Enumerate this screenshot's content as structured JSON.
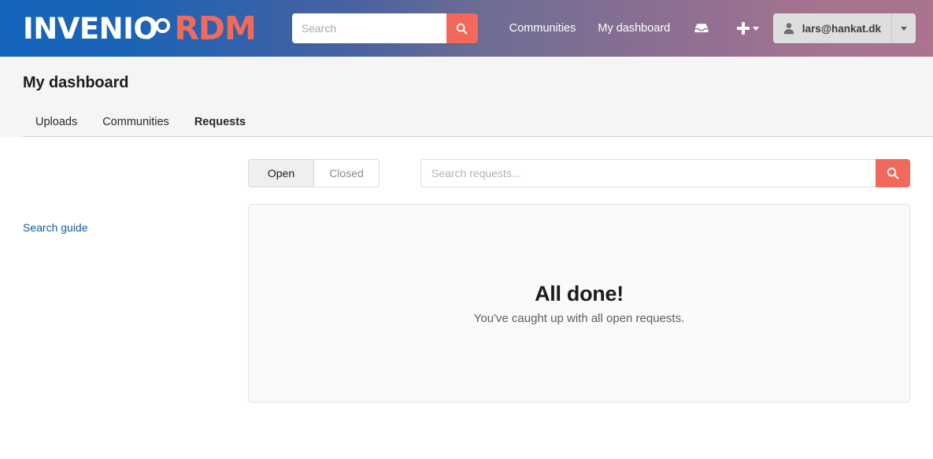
{
  "brand": {
    "name_primary": "INVENIO",
    "name_secondary": "RDM",
    "lens_icon": "magnifier-icon"
  },
  "navbar": {
    "search": {
      "placeholder": "Search",
      "value": "",
      "button_icon": "search-icon"
    },
    "links": [
      {
        "label": "Communities"
      },
      {
        "label": "My dashboard"
      }
    ],
    "inbox_icon": "inbox-icon",
    "plus_menu": {
      "icon": "plus-icon",
      "caret_icon": "chevron-down-icon"
    },
    "user": {
      "avatar_icon": "user-icon",
      "email": "lars@hankat.dk",
      "caret_icon": "chevron-down-icon"
    }
  },
  "page": {
    "title": "My dashboard",
    "tabs": [
      {
        "label": "Uploads",
        "active": false
      },
      {
        "label": "Communities",
        "active": false
      },
      {
        "label": "Requests",
        "active": true
      }
    ]
  },
  "filters": {
    "segments": [
      {
        "label": "Open",
        "active": true
      },
      {
        "label": "Closed",
        "active": false
      }
    ],
    "search": {
      "placeholder": "Search requests...",
      "value": "",
      "button_icon": "search-icon"
    }
  },
  "sidebar": {
    "search_guide_label": "Search guide"
  },
  "results": {
    "empty_title": "All done!",
    "empty_subtitle": "You've caught up with all open requests."
  },
  "colors": {
    "accent": "#f2695c",
    "brand_blue": "#1565bd",
    "link_blue": "#1359a0",
    "header_gradient_end": "#aa7390"
  }
}
